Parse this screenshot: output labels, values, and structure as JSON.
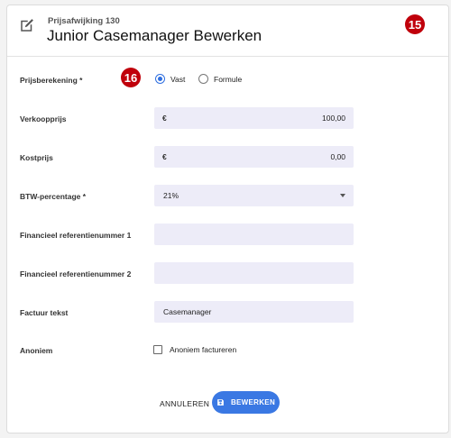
{
  "header": {
    "subtitle": "Prijsafwijking 130",
    "title": "Junior Casemanager Bewerken"
  },
  "badges": {
    "top_right": "15",
    "pricing": "16"
  },
  "form": {
    "pricing": {
      "label": "Prijsberekening *",
      "options": [
        {
          "label": "Vast",
          "checked": true
        },
        {
          "label": "Formule",
          "checked": false
        }
      ]
    },
    "sale_price": {
      "label": "Verkoopprijs",
      "prefix": "€",
      "value": "100,00"
    },
    "cost_price": {
      "label": "Kostprijs",
      "prefix": "€",
      "value": "0,00"
    },
    "vat": {
      "label": "BTW-percentage *",
      "value": "21%"
    },
    "ref1": {
      "label": "Financieel referentienummer 1",
      "value": ""
    },
    "ref2": {
      "label": "Financieel referentienummer 2",
      "value": ""
    },
    "invoice_text": {
      "label": "Factuur tekst",
      "value": "Casemanager"
    },
    "anonymous": {
      "label": "Anoniem",
      "checkbox_label": "Anoniem factureren",
      "checked": false
    }
  },
  "actions": {
    "cancel": "ANNULEREN",
    "save": "BEWERKEN"
  },
  "colors": {
    "accent": "#3a78e3",
    "badge": "#c0000b",
    "field_bg": "#edecf8"
  },
  "icons": {
    "header": "edit-icon",
    "save": "save-icon",
    "select": "caret-down-icon"
  }
}
